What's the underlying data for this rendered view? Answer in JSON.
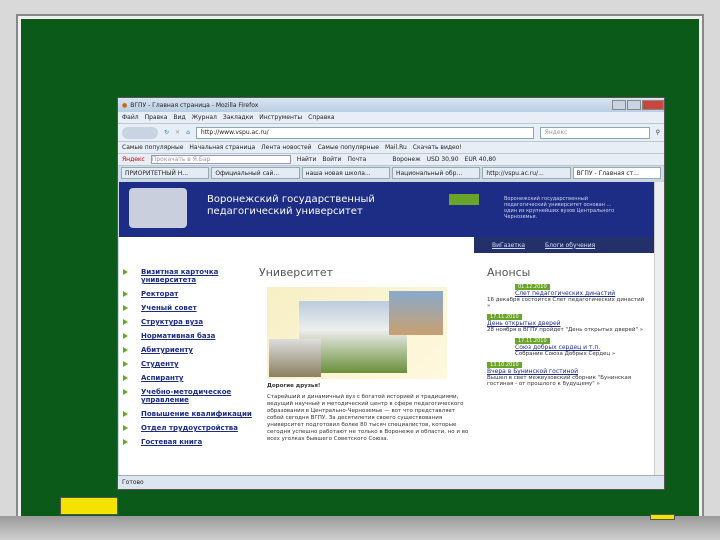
{
  "window": {
    "title": "ВГПУ - Главная страница - Mozilla Firefox"
  },
  "menubar": [
    "Файл",
    "Правка",
    "Вид",
    "Журнал",
    "Закладки",
    "Инструменты",
    "Справка"
  ],
  "navbar": {
    "url": "http://www.vspu.ac.ru/",
    "search_placeholder": "Яндекс"
  },
  "bookmarks": [
    "Самые популярные",
    "Начальная страница",
    "Лента новостей",
    "Самые популярные",
    "Mail.Ru",
    "Скачать видео!"
  ],
  "yandexbar": {
    "label": "Яндекс",
    "placeholder": "Прокачать в Я.Бар",
    "find": "Найти",
    "vkontakte": "Войти",
    "mail": "Почта",
    "weather": "Воронеж",
    "usd": "USD 30,90",
    "eur": "EUR 40,80"
  },
  "tabs": [
    "ПРИОРИТЕТНЫЙ Н...",
    "Официальный сай...",
    "наша новая школа...",
    "Национальный обр...",
    "http://vspu.ac.ru/...",
    "ВГПУ - Главная ст..."
  ],
  "site": {
    "name_line1": "Воронежский государственный",
    "name_line2": "педагогический университет",
    "header_text": "Воронежский государственный педагогический университет основан ... один из крупнейших вузов Центрального Черноземья.",
    "links": [
      "ВиГазетка",
      "Блоги обучения"
    ],
    "menu": [
      "Визитная карточка университета",
      "Ректорат",
      "Ученый совет",
      "Структура вуза",
      "Нормативная база",
      "Абитуриенту",
      "Студенту",
      "Аспиранту",
      "Учебно-методическое управление",
      "Повышение квалификации",
      "Отдел трудоустройства",
      "Гостевая книга"
    ],
    "main_title": "Университет",
    "greeting": "Дорогие друзья!",
    "body": "Старейший и динамичный вуз с богатой историей и традициями, ведущий научный и методический центр в сфере педагогического образования в Центрально-Черноземье — вот что представляет собой сегодня ВГПУ. За десятилетия своего существования университет подготовил более 80 тысяч специалистов, которые сегодня успешно работают не только в Воронеже и области, но и во всех уголках бывшего Советского Союза.",
    "ann_title": "Анонсы",
    "announcements": [
      {
        "date": "01.12.2010",
        "title": "Слет педагогических династий",
        "text": "16 декабря состоится Слет педагогических династий »"
      },
      {
        "date": "17.11.2010",
        "title": "День открытых дверей",
        "text": "28 ноября в ВГПУ пройдет \"День открытых дверей\" »"
      },
      {
        "date": "17.11.2010",
        "title": "Союз добрых сердец и т.п.",
        "text": "Собрание Союза Добрых Сердец »"
      },
      {
        "date": "13.10.2010",
        "title": "Вчера в Бунинской гостиной",
        "text": "Вышел в свет межвузовский сборник \"Бунинская гостиная - от прошлого к будущему\" »"
      }
    ]
  },
  "status": "Готово"
}
